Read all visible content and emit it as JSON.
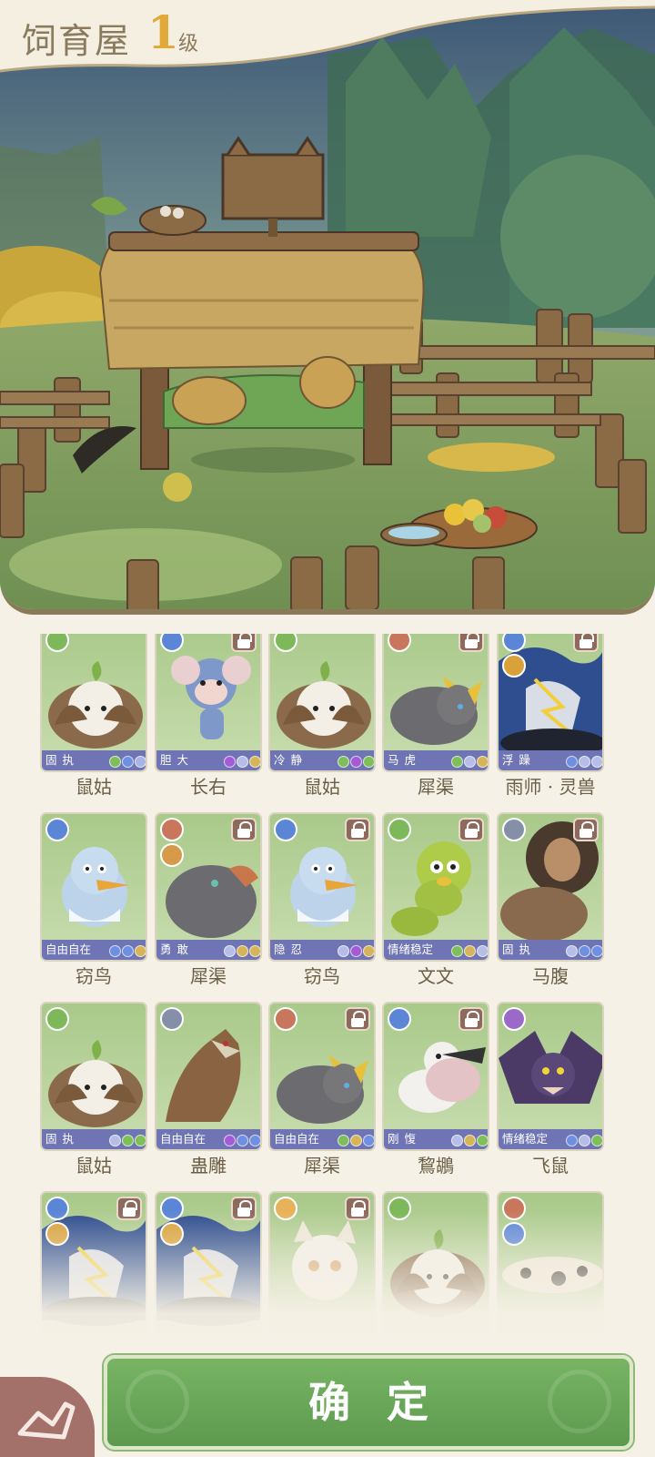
{
  "header": {
    "title": "饲育屋",
    "level": "1",
    "level_unit": "级"
  },
  "pets": [
    {
      "trait": "固 执",
      "name": "鼠姑",
      "element": "grass-icon",
      "locked": false,
      "dots": [
        "#7fbf5a",
        "#6f8fe0",
        "#a9b3e6"
      ],
      "creature": "seed"
    },
    {
      "trait": "胆 大",
      "name": "长右",
      "element": "water-icon",
      "locked": true,
      "dots": [
        "#a45cd6",
        "#b6bde6",
        "#d6b45a"
      ],
      "creature": "monkey"
    },
    {
      "trait": "冷 静",
      "name": "鼠姑",
      "element": "grass-icon",
      "locked": false,
      "dots": [
        "#7fbf5a",
        "#a45cd6",
        "#7fbf5a"
      ],
      "creature": "seed"
    },
    {
      "trait": "马 虎",
      "name": "犀渠",
      "element": "fire-icon",
      "locked": true,
      "dots": [
        "#7fbf5a",
        "#b6bde6",
        "#d6b45a"
      ],
      "creature": "rhino"
    },
    {
      "trait": "浮 躁",
      "name": "雨师 · 灵兽",
      "element": "water-icon",
      "element2": "thunder-icon",
      "locked": true,
      "dots": [
        "#6f8fe0",
        "#b6bde6",
        "#b6bde6"
      ],
      "creature": "dragon"
    },
    {
      "trait": "自由自在",
      "name": "窃鸟",
      "element": "water-icon",
      "locked": false,
      "dots": [
        "#6f8fe0",
        "#6f8fe0",
        "#d6b45a"
      ],
      "creature": "duck"
    },
    {
      "trait": "勇 敢",
      "name": "犀渠",
      "element": "fire-icon",
      "element2": "earth-icon",
      "locked": true,
      "dots": [
        "#b6bde6",
        "#d6b45a",
        "#d6b45a"
      ],
      "creature": "rhino2"
    },
    {
      "trait": "隐 忍",
      "name": "窃鸟",
      "element": "water-icon",
      "locked": true,
      "dots": [
        "#b6bde6",
        "#a45cd6",
        "#d6b45a"
      ],
      "creature": "duck"
    },
    {
      "trait": "情绪稳定",
      "name": "文文",
      "element": "grass-icon",
      "locked": true,
      "dots": [
        "#7fbf5a",
        "#d6b45a",
        "#b6bde6"
      ],
      "creature": "worm"
    },
    {
      "trait": "固 执",
      "name": "马腹",
      "element": "wind-icon",
      "locked": true,
      "dots": [
        "#b6bde6",
        "#6f8fe0",
        "#6f8fe0"
      ],
      "creature": "lion"
    },
    {
      "trait": "固 执",
      "name": "鼠姑",
      "element": "grass-icon",
      "locked": false,
      "dots": [
        "#b6bde6",
        "#7fbf5a",
        "#7fbf5a"
      ],
      "creature": "seed"
    },
    {
      "trait": "自由自在",
      "name": "蛊雕",
      "element": "wind-icon",
      "locked": false,
      "dots": [
        "#a45cd6",
        "#6f8fe0",
        "#6f8fe0"
      ],
      "creature": "eagle"
    },
    {
      "trait": "自由自在",
      "name": "犀渠",
      "element": "fire-icon",
      "locked": true,
      "dots": [
        "#7fbf5a",
        "#d6b45a",
        "#6f8fe0"
      ],
      "creature": "rhino"
    },
    {
      "trait": "刚 愎",
      "name": "鵹鶘",
      "element": "water-icon",
      "locked": true,
      "dots": [
        "#b6bde6",
        "#d6b45a",
        "#7fbf5a"
      ],
      "creature": "pelican"
    },
    {
      "trait": "情绪稳定",
      "name": "飞鼠",
      "element": "spirit-icon",
      "locked": false,
      "dots": [
        "#6f8fe0",
        "#b6bde6",
        "#7fbf5a"
      ],
      "creature": "bat"
    },
    {
      "trait": "",
      "name": "",
      "element": "water-icon",
      "element2": "thunder-icon",
      "locked": true,
      "dots": [],
      "creature": "dragon"
    },
    {
      "trait": "",
      "name": "",
      "element": "water-icon",
      "element2": "thunder-icon",
      "locked": true,
      "dots": [],
      "creature": "dragon"
    },
    {
      "trait": "",
      "name": "",
      "element": "light-icon",
      "locked": true,
      "dots": [],
      "creature": "cat"
    },
    {
      "trait": "",
      "name": "",
      "element": "grass-icon",
      "locked": false,
      "dots": [],
      "creature": "seed"
    },
    {
      "trait": "",
      "name": "",
      "element": "fire-icon",
      "element2": "water-icon",
      "locked": false,
      "dots": [],
      "creature": "salamander"
    }
  ],
  "element_colors": {
    "grass-icon": "#7db85a",
    "water-icon": "#5b86d6",
    "fire-icon": "#c9775c",
    "thunder-icon": "#d9a13a",
    "earth-icon": "#d79a4a",
    "wind-icon": "#8590a8",
    "spirit-icon": "#9b6ac9",
    "light-icon": "#e6b35a"
  },
  "confirm_button": {
    "label": "确定"
  }
}
